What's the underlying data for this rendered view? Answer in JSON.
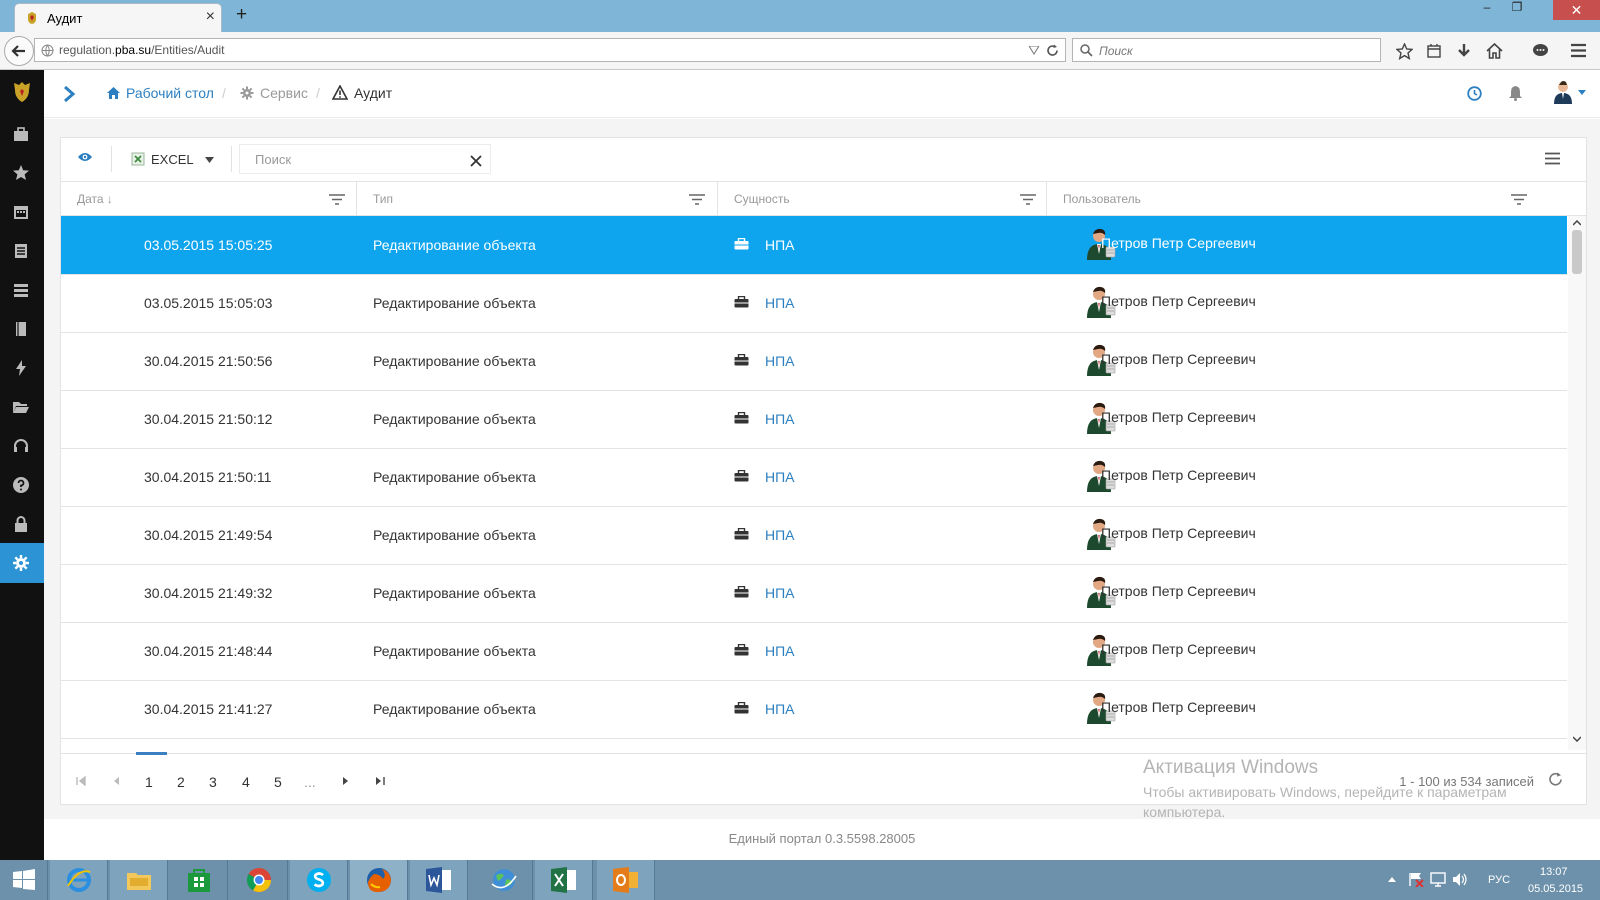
{
  "browser": {
    "tab_title": "Аудит",
    "url_plain": "regulation.",
    "url_host": "pba.su",
    "url_path": "/Entities/Audit",
    "search_placeholder": "Поиск"
  },
  "breadcrumb": {
    "home": "Рабочий стол",
    "service": "Сервис",
    "current": "Аудит"
  },
  "toolbar": {
    "excel_label": "EXCEL",
    "search_placeholder": "Поиск"
  },
  "columns": {
    "date": "Дата ↓",
    "type": "Тип",
    "entity": "Сущность",
    "user": "Пользователь"
  },
  "rows": [
    {
      "date": "03.05.2015 15:05:25",
      "type": "Редактирование объекта",
      "entity": "НПА",
      "user": "Петров Петр Сергеевич",
      "selected": true
    },
    {
      "date": "03.05.2015 15:05:03",
      "type": "Редактирование объекта",
      "entity": "НПА",
      "user": "Петров Петр Сергеевич"
    },
    {
      "date": "30.04.2015 21:50:56",
      "type": "Редактирование объекта",
      "entity": "НПА",
      "user": "Петров Петр Сергеевич"
    },
    {
      "date": "30.04.2015 21:50:12",
      "type": "Редактирование объекта",
      "entity": "НПА",
      "user": "Петров Петр Сергеевич"
    },
    {
      "date": "30.04.2015 21:50:11",
      "type": "Редактирование объекта",
      "entity": "НПА",
      "user": "Петров Петр Сергеевич"
    },
    {
      "date": "30.04.2015 21:49:54",
      "type": "Редактирование объекта",
      "entity": "НПА",
      "user": "Петров Петр Сергеевич"
    },
    {
      "date": "30.04.2015 21:49:32",
      "type": "Редактирование объекта",
      "entity": "НПА",
      "user": "Петров Петр Сергеевич"
    },
    {
      "date": "30.04.2015 21:48:44",
      "type": "Редактирование объекта",
      "entity": "НПА",
      "user": "Петров Петр Сергеевич"
    },
    {
      "date": "30.04.2015 21:41:27",
      "type": "Редактирование объекта",
      "entity": "НПА",
      "user": "Петров Петр Сергеевич"
    }
  ],
  "pager": {
    "pages": [
      "1",
      "2",
      "3",
      "4",
      "5",
      "..."
    ],
    "current_page": "1",
    "info": "1 - 100 из 534 записей"
  },
  "watermark": {
    "title": "Активация Windows",
    "subtitle": "Чтобы активировать Windows, перейдите к параметрам компьютера."
  },
  "footer": {
    "text": "Единый портал 0.3.5598.28005"
  },
  "taskbar": {
    "language": "РУС",
    "time": "13:07",
    "date": "05.05.2015"
  },
  "colors": {
    "selected_row": "#0ea5ee",
    "link": "#2c7fc0",
    "sidebar": "#111111",
    "sidebar_active": "#2c94d5"
  }
}
